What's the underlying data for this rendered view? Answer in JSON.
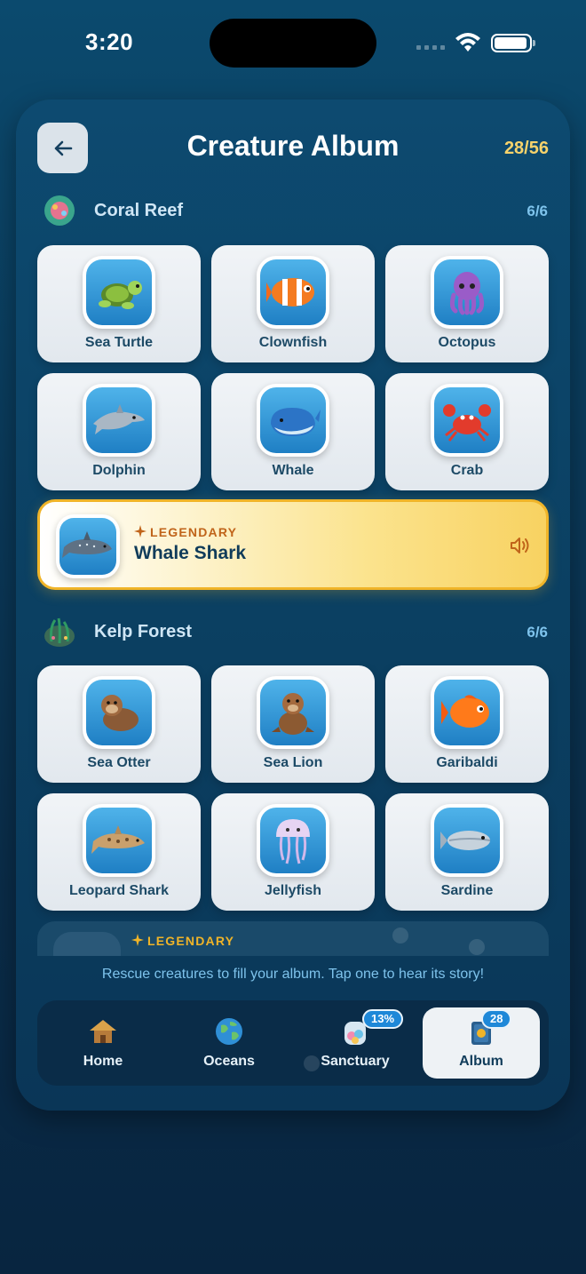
{
  "status": {
    "time": "3:20"
  },
  "header": {
    "title": "Creature Album",
    "count": "28/56"
  },
  "sections": [
    {
      "name": "Coral Reef",
      "count": "6/6",
      "creatures": [
        "Sea Turtle",
        "Clownfish",
        "Octopus",
        "Dolphin",
        "Whale",
        "Crab"
      ],
      "legendary": {
        "tag": "LEGENDARY",
        "name": "Whale Shark"
      }
    },
    {
      "name": "Kelp Forest",
      "count": "6/6",
      "creatures": [
        "Sea Otter",
        "Sea Lion",
        "Garibaldi",
        "Leopard Shark",
        "Jellyfish",
        "Sardine"
      ],
      "legendary": {
        "tag": "LEGENDARY"
      }
    }
  ],
  "helper": "Rescue creatures to fill your album. Tap one to hear its story!",
  "nav": {
    "home": "Home",
    "oceans": "Oceans",
    "sanctuary": "Sanctuary",
    "sanctuary_badge": "13%",
    "album": "Album",
    "album_badge": "28"
  },
  "icons": {
    "back": "arrow-left-icon",
    "speaker": "speaker-icon",
    "sparkle": "sparkle-icon"
  },
  "colors": {
    "accent_gold": "#f0b428",
    "count_gold": "#f7d36b",
    "nav_blue": "#1e88d8"
  }
}
